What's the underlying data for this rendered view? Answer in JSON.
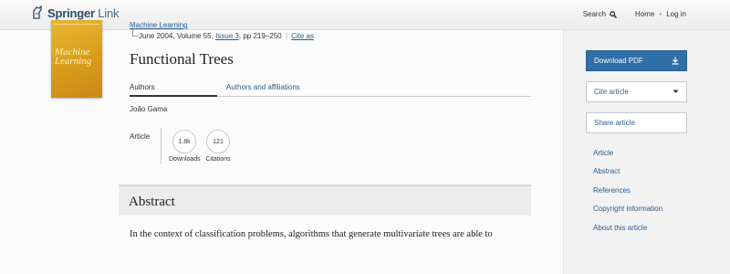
{
  "header": {
    "logo_bold": "Springer",
    "logo_light": "Link",
    "search_label": "Search",
    "home_label": "Home",
    "separator": "•",
    "login_label": "Log in"
  },
  "cover": {
    "journal_title": "Machine Learning"
  },
  "meta": {
    "journal": "Machine Learning",
    "date_volume": "June 2004, Volume 55,",
    "issue": "Issue 3",
    "pages": ", pp 219–250",
    "pipe": "|",
    "cite_as": "Cite as"
  },
  "article": {
    "title": "Functional Trees",
    "tab_authors": "Authors",
    "tab_affiliations": "Authors and affiliations",
    "author_name": "João Gama",
    "type_label": "Article",
    "downloads_value": "1.8k",
    "downloads_label": "Downloads",
    "citations_value": "121",
    "citations_label": "Citations"
  },
  "abstract": {
    "heading": "Abstract",
    "text": "In the context of classification problems, algorithms that generate multivariate trees are able to"
  },
  "sidebar": {
    "download_pdf": "Download PDF",
    "cite_article": "Cite article",
    "share_article": "Share article",
    "links": [
      "Article",
      "Abstract",
      "References",
      "Copyright information",
      "About this article"
    ]
  },
  "colors": {
    "brand": "#2d4e6a",
    "link": "#2a5d8f",
    "primary_button": "#2f6fa8",
    "cover": "#d69a18"
  },
  "icons": [
    "springer-horse-icon",
    "search-icon",
    "download-icon",
    "chevron-down-icon"
  ]
}
